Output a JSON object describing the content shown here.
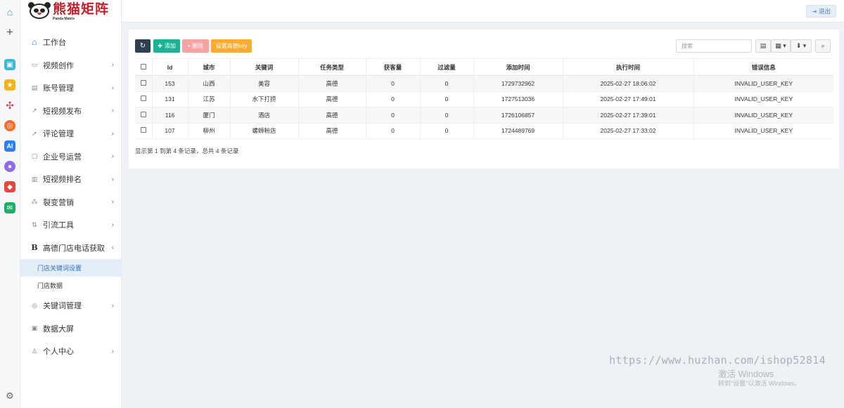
{
  "header": {
    "logout_label": "退出"
  },
  "logo": {
    "title": "熊猫矩阵",
    "subtitle": "Panda Matrix"
  },
  "sidebar": {
    "items": [
      {
        "label": "工作台",
        "icon": "home-icon"
      },
      {
        "label": "视频创作",
        "icon": "video-icon"
      },
      {
        "label": "账号管理",
        "icon": "account-icon"
      },
      {
        "label": "短视频发布",
        "icon": "send-icon"
      },
      {
        "label": "评论管理",
        "icon": "send-icon"
      },
      {
        "label": "企业号运营",
        "icon": "enterprise-icon"
      },
      {
        "label": "短视频排名",
        "icon": "chart-icon"
      },
      {
        "label": "裂变营销",
        "icon": "network-icon"
      },
      {
        "label": "引流工具",
        "icon": "sort-icon"
      },
      {
        "label": "高德门店电话获取",
        "icon": "B"
      },
      {
        "label": "门店关键词设置"
      },
      {
        "label": "门店数据"
      },
      {
        "label": "关键词管理",
        "icon": "target-icon"
      },
      {
        "label": "数据大屏",
        "icon": "screen-icon"
      },
      {
        "label": "个人中心",
        "icon": "user-icon"
      }
    ]
  },
  "toolbar": {
    "add_label": "添加",
    "delete_label": "删除",
    "set_key_label": "设置高德key",
    "search_placeholder": "搜索"
  },
  "table": {
    "columns": [
      "Id",
      "城市",
      "关键词",
      "任务类型",
      "获客量",
      "过滤量",
      "添加时间",
      "执行时间",
      "错误信息"
    ],
    "rows": [
      [
        "153",
        "山西",
        "美容",
        "高德",
        "0",
        "0",
        "1729732962",
        "2025-02-27 18:06:02",
        "INVALID_USER_KEY"
      ],
      [
        "131",
        "江苏",
        "水下打捞",
        "高德",
        "0",
        "0",
        "1727513036",
        "2025-02-27 17:49:01",
        "INVALID_USER_KEY"
      ],
      [
        "116",
        "厦门",
        "酒店",
        "高德",
        "0",
        "0",
        "1726106857",
        "2025-02-27 17:39:01",
        "INVALID_USER_KEY"
      ],
      [
        "107",
        "柳州",
        "螺蛳粉店",
        "高德",
        "0",
        "0",
        "1724489769",
        "2025-02-27 17:33:02",
        "INVALID_USER_KEY"
      ]
    ]
  },
  "pagination": {
    "summary": "显示第 1 到第 4 条记录，总共 4 条记录"
  },
  "watermark": {
    "url": "https://www.huzhan.com/ishop52814",
    "activate_title": "激活 Windows",
    "activate_hint": "转到\"设置\"以激活 Windows。"
  },
  "colors": {
    "accent": "#1ab394",
    "danger": "#f5a3a3",
    "warning": "#f8ac30",
    "dark": "#2f4050",
    "active_menu_bg": "#e3eef9"
  }
}
